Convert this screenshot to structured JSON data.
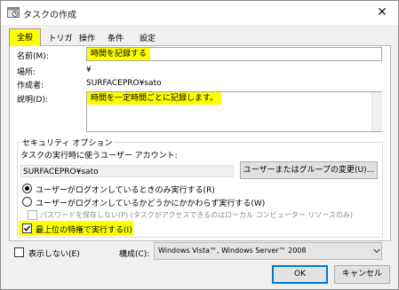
{
  "window": {
    "title": "タスクの作成",
    "close_glyph": "✕"
  },
  "tabs": [
    {
      "label": "全般"
    },
    {
      "label": "トリガー"
    },
    {
      "label": "操作"
    },
    {
      "label": "条件"
    },
    {
      "label": "設定"
    }
  ],
  "general": {
    "name_label": "名前(M):",
    "name_value": "時間を記録する",
    "location_label": "場所:",
    "location_value": "¥",
    "author_label": "作成者:",
    "author_value": "SURFACEPRO¥sato",
    "description_label": "説明(D):",
    "description_value": "時間を一定時間ごとに記録します。"
  },
  "security": {
    "title": "セキュリティ オプション",
    "user_account_label": "タスクの実行時に使うユーザー アカウント:",
    "user_account_value": "SURFACEPRO¥sato",
    "change_button": "ユーザーまたはグループの変更(U)...",
    "radio_logged_on": "ユーザーがログオンしているときのみ実行する(R)",
    "radio_whether_logged_on": "ユーザーがログオンしているかどうかにかかわらず実行する(W)",
    "checkbox_no_password": "パスワードを保存しない(P) (タスクがアクセスできるのはローカル コンピューター リソースのみ)",
    "checkbox_highest": "最上位の特権で実行する(I)",
    "selected_radio": "logged_on",
    "highest_checked": true,
    "no_password_checked": false
  },
  "footer": {
    "hidden_label": "表示しない(E)",
    "hidden_checked": false,
    "configure_label": "構成(C):",
    "configure_value": "Windows Vista™, Windows Server™ 2008",
    "ok_button": "OK",
    "cancel_button": "キャンセル"
  },
  "colors": {
    "highlight": "#ffff00",
    "accent": "#0078d7"
  },
  "icons": {
    "app": "task-scheduler-icon",
    "check": "checkmark-icon",
    "chevron": "chevron-down-icon"
  }
}
